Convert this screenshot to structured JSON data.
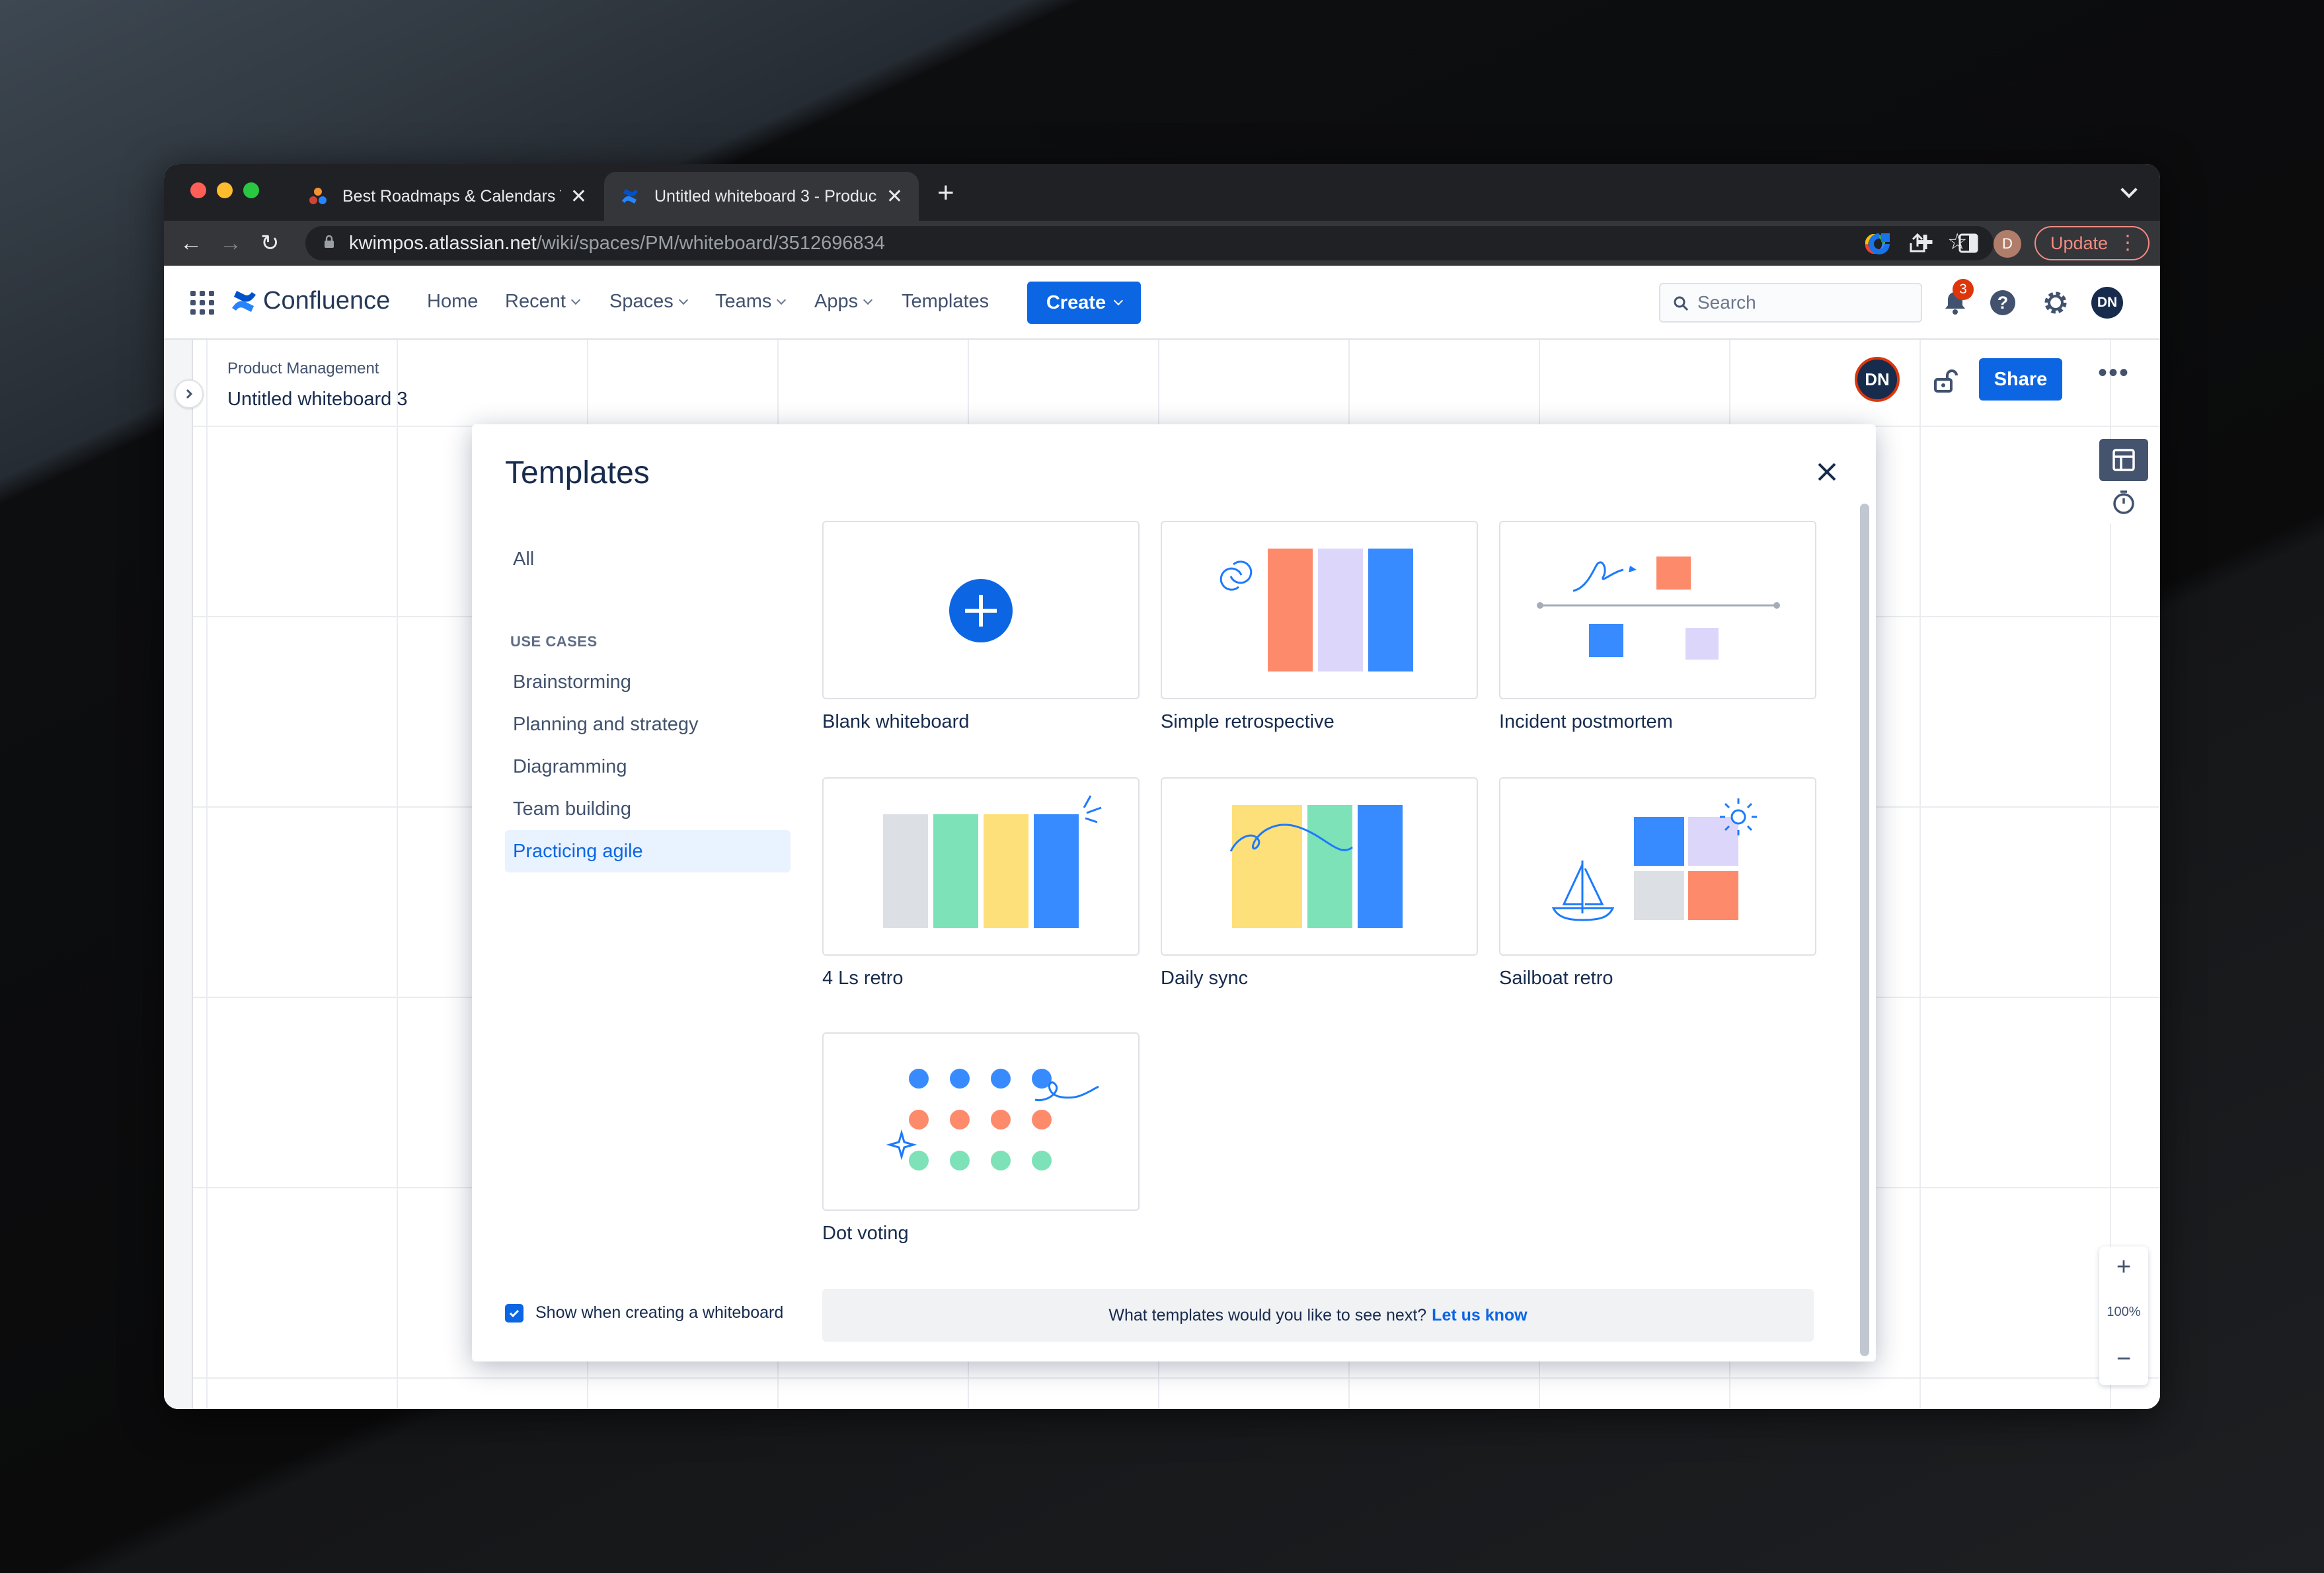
{
  "browser": {
    "tabs": [
      {
        "title": "Best Roadmaps & Calendars Te",
        "active": false
      },
      {
        "title": "Untitled whiteboard 3 - Produc",
        "active": true
      }
    ],
    "url_host": "kwimpos.atlassian.net",
    "url_path": "/wiki/spaces/PM/whiteboard/3512696834",
    "profile_initial": "D",
    "update_label": "Update"
  },
  "nav": {
    "product": "Confluence",
    "items": [
      {
        "label": "Home",
        "dropdown": false
      },
      {
        "label": "Recent",
        "dropdown": true
      },
      {
        "label": "Spaces",
        "dropdown": true
      },
      {
        "label": "Teams",
        "dropdown": true
      },
      {
        "label": "Apps",
        "dropdown": true
      },
      {
        "label": "Templates",
        "dropdown": false
      }
    ],
    "create_label": "Create",
    "search_placeholder": "Search",
    "notifications_count": "3",
    "user_initials": "DN"
  },
  "page": {
    "breadcrumb": "Product Management",
    "title": "Untitled whiteboard 3",
    "collaborator_initials": "DN",
    "share_label": "Share"
  },
  "zoom": {
    "level": "100%",
    "in": "+",
    "out": "−"
  },
  "modal": {
    "title": "Templates",
    "all_label": "All",
    "section_heading": "USE CASES",
    "categories": [
      "Brainstorming",
      "Planning and strategy",
      "Diagramming",
      "Team building",
      "Practicing agile"
    ],
    "selected_category": "Practicing agile",
    "templates": [
      {
        "name": "Blank whiteboard"
      },
      {
        "name": "Simple retrospective"
      },
      {
        "name": "Incident postmortem"
      },
      {
        "name": "4 Ls retro"
      },
      {
        "name": "Daily sync"
      },
      {
        "name": "Sailboat retro"
      },
      {
        "name": "Dot voting"
      }
    ],
    "show_when_creating": "Show when creating a whiteboard",
    "show_checked": true,
    "feedback_text": "What templates would you like to see next?",
    "feedback_link": "Let us know"
  },
  "colors": {
    "primary": "#0c66e4",
    "coral": "#fd8b6b",
    "lavender": "#dcd6fa",
    "blue": "#388bff",
    "green": "#7ee2b8",
    "yellow": "#fee07a",
    "gray": "#dcdfe4"
  }
}
